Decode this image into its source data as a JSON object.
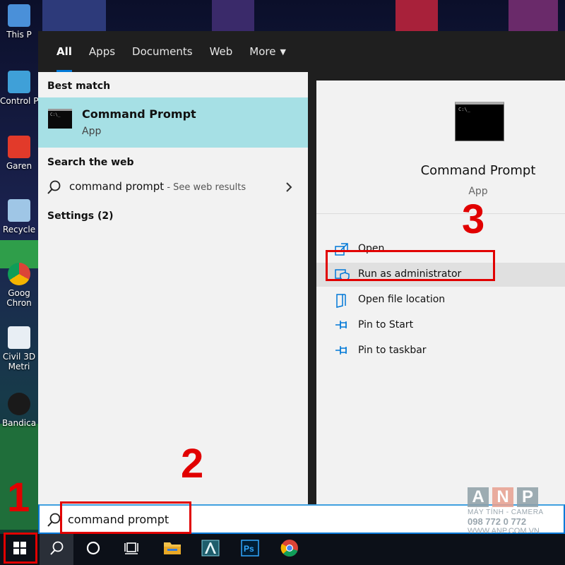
{
  "desktop": {
    "icons": [
      {
        "label": "This P",
        "icon": "this-pc-icon"
      },
      {
        "label": "Control P",
        "icon": "control-panel-icon"
      },
      {
        "label": "Garen",
        "icon": "garena-icon"
      },
      {
        "label": "Recycle",
        "icon": "recycle-bin-icon"
      },
      {
        "label": "Goog",
        "label2": "Chron",
        "icon": "chrome-shortcut-icon"
      },
      {
        "label": "Civil 3D",
        "label2": "Metri",
        "icon": "civil3d-icon"
      },
      {
        "label": "Bandica",
        "icon": "bandicam-icon"
      }
    ]
  },
  "tabs": [
    {
      "label": "All",
      "active": true
    },
    {
      "label": "Apps"
    },
    {
      "label": "Documents"
    },
    {
      "label": "Web"
    },
    {
      "label": "More"
    }
  ],
  "left": {
    "best_match_heading": "Best match",
    "best_match": {
      "title": "Command Prompt",
      "subtitle": "App"
    },
    "web_heading": "Search the web",
    "web_result": {
      "query": "command prompt",
      "suffix": " - See web results"
    },
    "settings_heading": "Settings (2)"
  },
  "right": {
    "app_title": "Command Prompt",
    "app_subtitle": "App",
    "icon_text": "C:\\_",
    "actions": [
      {
        "label": "Open",
        "icon": "open-icon"
      },
      {
        "label": "Run as administrator",
        "icon": "shield-icon",
        "hovered": true
      },
      {
        "label": "Open file location",
        "icon": "file-location-icon"
      },
      {
        "label": "Pin to Start",
        "icon": "pin-icon"
      },
      {
        "label": "Pin to taskbar",
        "icon": "pin-icon"
      }
    ]
  },
  "search": {
    "value": "command prompt"
  },
  "annotations": {
    "step1": "1",
    "step2": "2",
    "step3": "3"
  },
  "watermark": {
    "letters": [
      "A",
      "N",
      "P"
    ],
    "line1": "MÁY TÍNH - CAMERA",
    "line2": "098 772 0 772",
    "line3": "WWW.ANP.COM.VN"
  },
  "colors": {
    "accent": "#0078d7",
    "best_match_bg": "#a6e0e5",
    "annotation_red": "#e10000"
  }
}
